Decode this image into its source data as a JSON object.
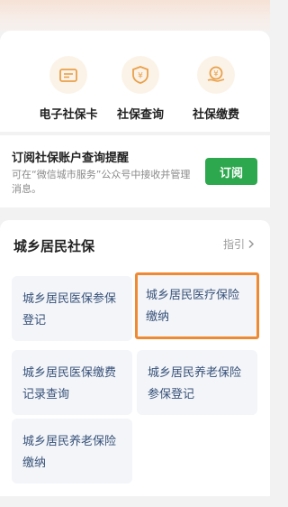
{
  "services": [
    {
      "label": "电子社保卡",
      "icon": "card-icon"
    },
    {
      "label": "社保查询",
      "icon": "shield-yen-icon"
    },
    {
      "label": "社保缴费",
      "icon": "coin-hand-icon"
    }
  ],
  "subscribe": {
    "title": "订阅社保账户查询提醒",
    "description": "可在“微信城市服务”公众号中接收并管理消息。",
    "button_label": "订阅",
    "button_color": "#2ea84e"
  },
  "section": {
    "title": "城乡居民社保",
    "guide_label": "指引",
    "tiles": [
      {
        "label": "城乡居民医保参保登记"
      },
      {
        "label": "城乡居民医疗保险缴纳",
        "highlighted": true
      },
      {
        "label": "城乡居民医保缴费记录查询"
      },
      {
        "label": "城乡居民养老保险参保登记"
      },
      {
        "label": "城乡居民养老保险缴纳"
      }
    ]
  },
  "colors": {
    "accent_orange": "#f08a32",
    "icon_orange": "#e9a04a",
    "tile_text": "#37517a"
  }
}
